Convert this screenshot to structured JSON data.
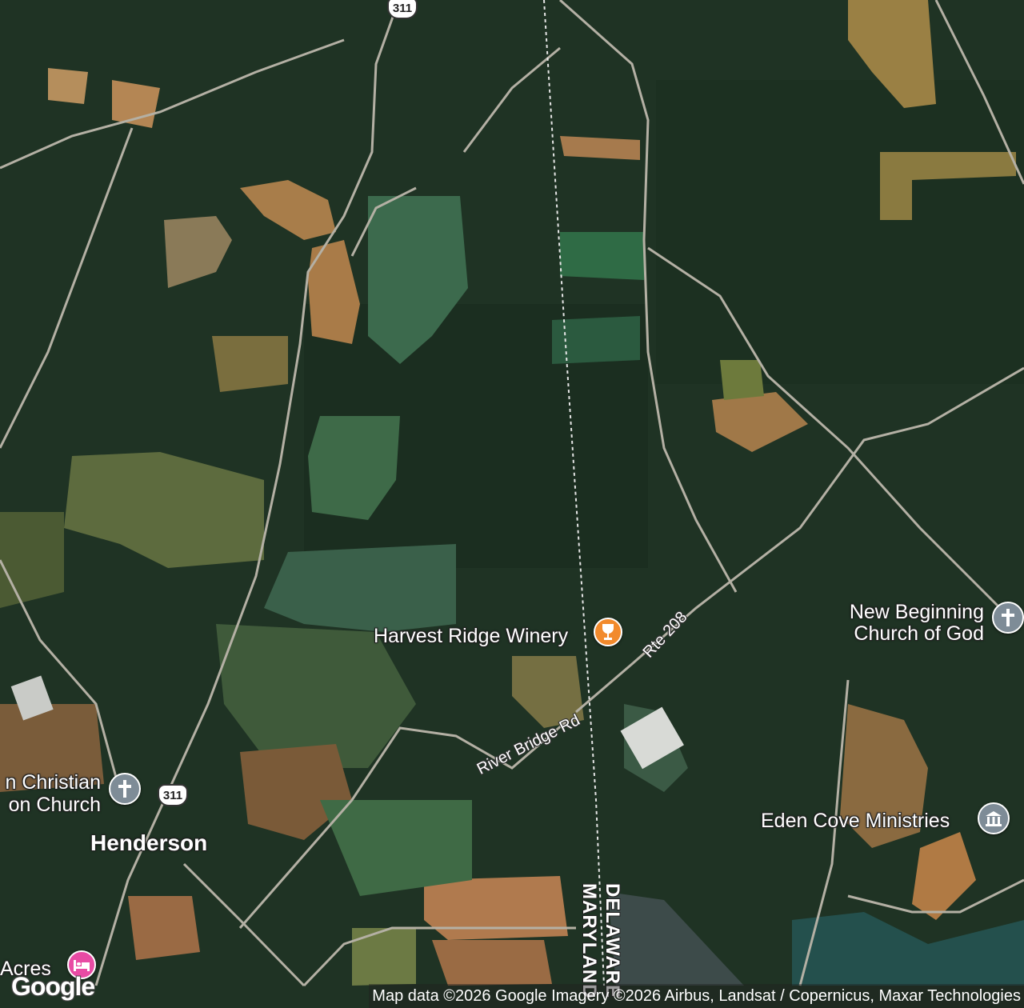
{
  "map": {
    "type": "satellite",
    "places": {
      "winery": "Harvest Ridge Winery",
      "church_ne_line1": "New Beginning",
      "church_ne_line2": "Church of God",
      "church_w_line1": "n Christian",
      "church_w_line2": "on Church",
      "ministries": "Eden Cove Ministries",
      "town": "Henderson",
      "hotel": "Acres"
    },
    "roads": {
      "route_top": "311",
      "route_mid": "311",
      "rte208": "Rte 208",
      "river_bridge": "River Bridge Rd"
    },
    "states": {
      "east": "DELAWARE",
      "west": "MARYLAND"
    },
    "icons": {
      "winery": "wine-glass-icon",
      "church": "cross-icon",
      "ministries": "temple-icon",
      "hotel": "bed-icon"
    },
    "colors": {
      "forest": "#1f3324",
      "winery_pin": "#f28a2c",
      "church_pin": "#7e8c97",
      "hotel_pin": "#e84ba4"
    }
  },
  "attribution": "Map data ©2026 Google Imagery ©2026 Airbus, Landsat / Copernicus, Maxar Technologies",
  "logo": "Google"
}
